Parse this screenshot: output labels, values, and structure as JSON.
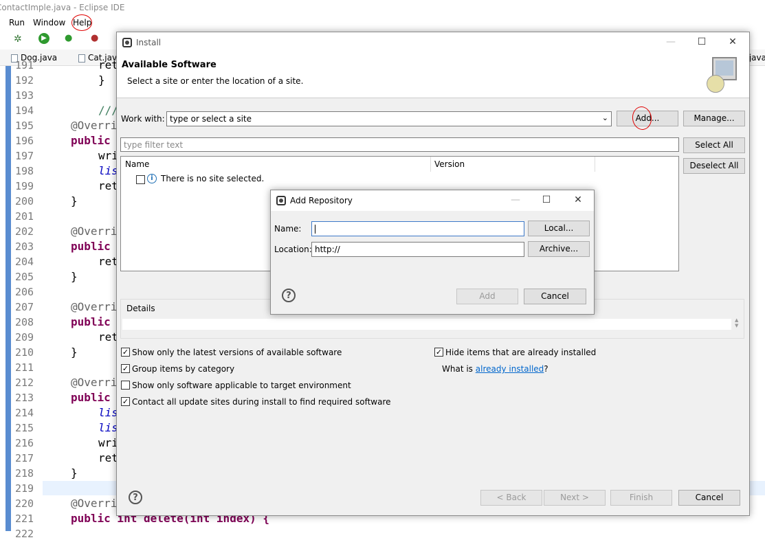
{
  "window": {
    "title": "ContactImple.java - Eclipse IDE"
  },
  "menubar": {
    "run": "Run",
    "window": "Window",
    "help": "Help"
  },
  "editor_tabs": [
    {
      "label": "Dog.java"
    },
    {
      "label": "Cat.java"
    },
    {
      "label": ".java"
    }
  ],
  "editor": {
    "line_numbers": [
      "191",
      "192",
      "193",
      "194",
      "195",
      "196",
      "197",
      "198",
      "199",
      "200",
      "201",
      "202",
      "203",
      "204",
      "205",
      "206",
      "207",
      "208",
      "209",
      "210",
      "211",
      "212",
      "213",
      "214",
      "215",
      "216",
      "217",
      "218",
      "219",
      "220",
      "221",
      "222"
    ],
    "code_lines": [
      "ret",
      "}",
      "",
      "///",
      "@Overri",
      "public",
      "wri",
      "lis",
      "ret",
      "}",
      "",
      "@Overri",
      "public",
      "ret",
      "}",
      "",
      "@Overri",
      "public",
      "ret",
      "}",
      "",
      "@Overri",
      "public",
      "lis",
      "lis",
      "wri",
      "ret",
      "}",
      "",
      "@Overri",
      "public int delete(int index) {",
      ""
    ]
  },
  "install_dialog": {
    "title": "Install",
    "heading": "Available Software",
    "subheading": "Select a site or enter the location of a site.",
    "work_with_label": "Work with:",
    "work_with_value": "type or select a site",
    "add_button": "Add...",
    "manage_button": "Manage...",
    "filter_placeholder": "type filter text",
    "select_all_button": "Select All",
    "deselect_all_button": "Deselect All",
    "col_name": "Name",
    "col_version": "Version",
    "no_site_text": "There is no site selected.",
    "details_label": "Details",
    "options": [
      {
        "label": "Show only the latest versions of available software",
        "checked": true
      },
      {
        "label": "Group items by category",
        "checked": true
      },
      {
        "label": "Show only software applicable to target environment",
        "checked": false
      },
      {
        "label": "Contact all update sites during install to find required software",
        "checked": true
      }
    ],
    "hide_installed_label": "Hide items that are already installed",
    "hide_installed_checked": true,
    "what_is_prefix": "What is ",
    "what_is_link": "already installed",
    "what_is_suffix": "?",
    "back_button": "< Back",
    "next_button": "Next >",
    "finish_button": "Finish",
    "cancel_button": "Cancel"
  },
  "add_repo_dialog": {
    "title": "Add Repository",
    "name_label": "Name:",
    "name_value": "",
    "location_label": "Location:",
    "location_value": "http://",
    "local_button": "Local...",
    "archive_button": "Archive...",
    "add_button": "Add",
    "cancel_button": "Cancel"
  },
  "colors": {
    "accent": "#3c78c8",
    "annotation": "#e00000",
    "link": "#0066cc"
  }
}
